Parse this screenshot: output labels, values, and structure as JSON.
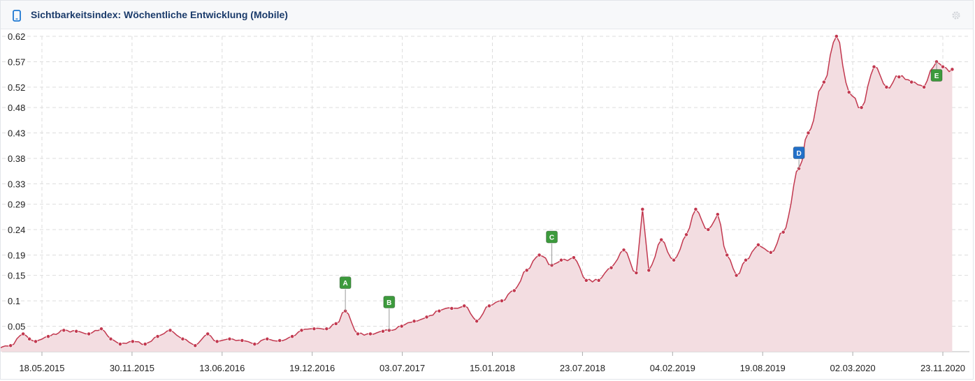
{
  "header": {
    "title": "Sichtbarkeitsindex: Wöchentliche Entwicklung (Mobile)",
    "icon": "mobile-phone-icon",
    "settings_icon": "gear-icon"
  },
  "colors": {
    "line": "#c2384f",
    "area": "#f3dde1",
    "marker": "#c2384f",
    "flag_green": "#3c9a3c",
    "flag_blue": "#2270c8",
    "grid": "#dddddd",
    "title": "#1b3b6b"
  },
  "chart_data": {
    "type": "area",
    "grid": true,
    "legend": "none",
    "y_ticks": [
      "0.62",
      "0.57",
      "0.52",
      "0.48",
      "0.43",
      "0.38",
      "0.33",
      "0.29",
      "0.24",
      "0.19",
      "0.15",
      "0.1",
      "0.05"
    ],
    "x_ticks": [
      "18.05.2015",
      "30.11.2015",
      "13.06.2016",
      "19.12.2016",
      "03.07.2017",
      "15.01.2018",
      "23.07.2018",
      "04.02.2019",
      "19.08.2019",
      "02.03.2020",
      "23.11.2020"
    ],
    "ylim": [
      0,
      0.62
    ],
    "points": [
      [
        "2014-12-15",
        0.005
      ],
      [
        "2015-01-26",
        0.005
      ],
      [
        "2015-03-09",
        0.012
      ],
      [
        "2015-04-06",
        0.035
      ],
      [
        "2015-04-20",
        0.025
      ],
      [
        "2015-05-04",
        0.02
      ],
      [
        "2015-06-01",
        0.03
      ],
      [
        "2015-07-06",
        0.042
      ],
      [
        "2015-08-03",
        0.04
      ],
      [
        "2015-08-31",
        0.035
      ],
      [
        "2015-09-28",
        0.045
      ],
      [
        "2015-10-19",
        0.025
      ],
      [
        "2015-11-09",
        0.015
      ],
      [
        "2015-12-07",
        0.02
      ],
      [
        "2016-01-04",
        0.015
      ],
      [
        "2016-02-01",
        0.03
      ],
      [
        "2016-02-29",
        0.042
      ],
      [
        "2016-03-28",
        0.025
      ],
      [
        "2016-04-25",
        0.012
      ],
      [
        "2016-05-23",
        0.035
      ],
      [
        "2016-06-13",
        0.02
      ],
      [
        "2016-07-11",
        0.025
      ],
      [
        "2016-08-08",
        0.022
      ],
      [
        "2016-09-05",
        0.015
      ],
      [
        "2016-10-03",
        0.025
      ],
      [
        "2016-10-31",
        0.022
      ],
      [
        "2016-11-28",
        0.03
      ],
      [
        "2016-12-19",
        0.042
      ],
      [
        "2017-01-16",
        0.045
      ],
      [
        "2017-02-13",
        0.045
      ],
      [
        "2017-03-06",
        0.055
      ],
      [
        "2017-03-27",
        0.08
      ],
      [
        "2017-04-24",
        0.035
      ],
      [
        "2017-05-22",
        0.035
      ],
      [
        "2017-06-19",
        0.04
      ],
      [
        "2017-07-03",
        0.042
      ],
      [
        "2017-07-31",
        0.05
      ],
      [
        "2017-08-28",
        0.06
      ],
      [
        "2017-09-25",
        0.068
      ],
      [
        "2017-10-23",
        0.08
      ],
      [
        "2017-11-20",
        0.085
      ],
      [
        "2017-12-18",
        0.09
      ],
      [
        "2018-01-15",
        0.06
      ],
      [
        "2018-02-12",
        0.09
      ],
      [
        "2018-03-12",
        0.1
      ],
      [
        "2018-04-09",
        0.12
      ],
      [
        "2018-05-07",
        0.16
      ],
      [
        "2018-06-04",
        0.19
      ],
      [
        "2018-07-02",
        0.17
      ],
      [
        "2018-07-23",
        0.18
      ],
      [
        "2018-08-20",
        0.185
      ],
      [
        "2018-09-17",
        0.14
      ],
      [
        "2018-10-15",
        0.14
      ],
      [
        "2018-11-12",
        0.165
      ],
      [
        "2018-12-10",
        0.2
      ],
      [
        "2019-01-07",
        0.155
      ],
      [
        "2019-01-21",
        0.28
      ],
      [
        "2019-02-04",
        0.16
      ],
      [
        "2019-03-04",
        0.22
      ],
      [
        "2019-04-01",
        0.18
      ],
      [
        "2019-04-29",
        0.23
      ],
      [
        "2019-05-20",
        0.28
      ],
      [
        "2019-06-17",
        0.24
      ],
      [
        "2019-07-08",
        0.27
      ],
      [
        "2019-07-29",
        0.19
      ],
      [
        "2019-08-19",
        0.15
      ],
      [
        "2019-09-09",
        0.18
      ],
      [
        "2019-10-07",
        0.21
      ],
      [
        "2019-11-04",
        0.195
      ],
      [
        "2019-12-02",
        0.235
      ],
      [
        "2020-01-06",
        0.36
      ],
      [
        "2020-01-27",
        0.43
      ],
      [
        "2020-03-02",
        0.53
      ],
      [
        "2020-03-30",
        0.62
      ],
      [
        "2020-04-27",
        0.51
      ],
      [
        "2020-05-25",
        0.48
      ],
      [
        "2020-06-22",
        0.56
      ],
      [
        "2020-07-20",
        0.52
      ],
      [
        "2020-08-17",
        0.54
      ],
      [
        "2020-09-14",
        0.53
      ],
      [
        "2020-10-12",
        0.52
      ],
      [
        "2020-11-09",
        0.57
      ],
      [
        "2020-11-23",
        0.56
      ],
      [
        "2020-12-14",
        0.555
      ]
    ],
    "annotations": [
      {
        "label": "A",
        "date": "2017-03-27",
        "value": 0.08,
        "color": "green"
      },
      {
        "label": "B",
        "date": "2017-07-03",
        "value": 0.042,
        "color": "green"
      },
      {
        "label": "C",
        "date": "2018-07-02",
        "value": 0.17,
        "color": "green"
      },
      {
        "label": "D",
        "date": "2020-01-06",
        "value": 0.36,
        "color": "blue"
      },
      {
        "label": "E",
        "date": "2020-11-09",
        "value": 0.57,
        "color": "green"
      }
    ]
  }
}
